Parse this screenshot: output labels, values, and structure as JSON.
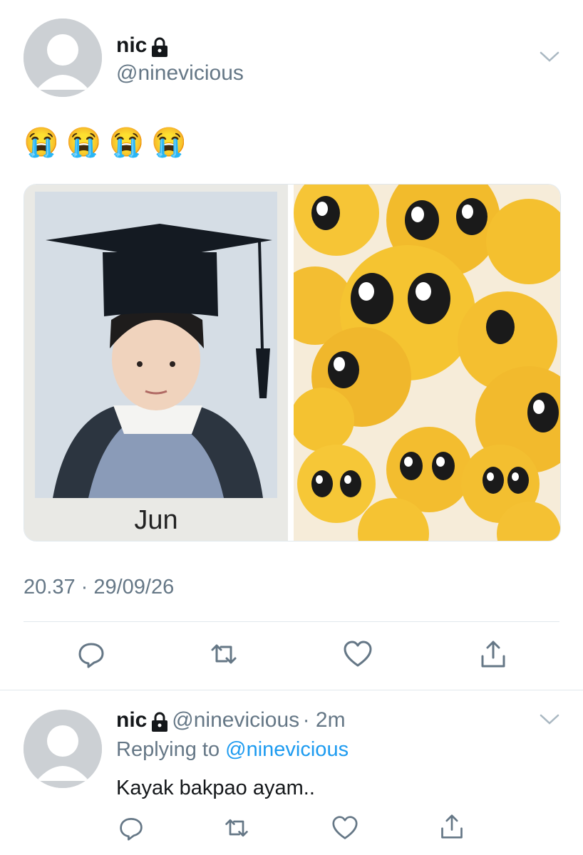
{
  "tweet": {
    "display_name": "nic",
    "handle": "@ninevicious",
    "text": "😭😭😭😭",
    "media_caption": "Jun",
    "timestamp": "20.37 · 29/09/26"
  },
  "reply": {
    "display_name": "nic",
    "handle": "@ninevicious",
    "age": "· 2m",
    "replying_prefix": "Replying to",
    "replying_to": "@ninevicious",
    "text": "Kayak bakpao ayam.."
  },
  "icons": [
    "lock-icon",
    "chevron-down-icon",
    "reply-icon",
    "retweet-icon",
    "like-icon",
    "share-icon"
  ],
  "colors": {
    "secondary_text": "#657786",
    "link": "#1d9bf0",
    "divider": "#e1e8ed"
  }
}
